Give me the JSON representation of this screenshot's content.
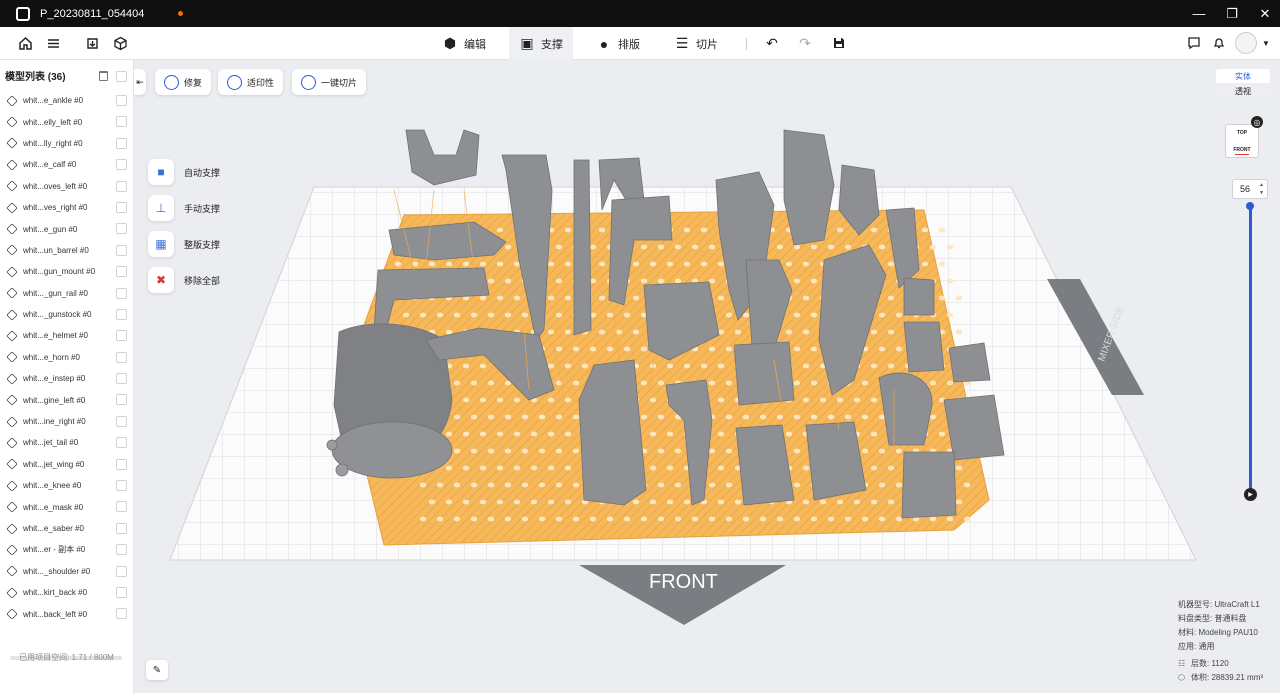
{
  "window": {
    "title": "P_20230811_054404",
    "controls": [
      "minimize",
      "maximize",
      "close"
    ]
  },
  "toolbar": {
    "tabs": [
      {
        "label": "编辑",
        "icon": "edit-cube-icon"
      },
      {
        "label": "支撑",
        "icon": "support-icon"
      },
      {
        "label": "排版",
        "icon": "arrange-icon"
      },
      {
        "label": "切片",
        "icon": "slice-icon"
      }
    ],
    "active_tab": "支撑"
  },
  "model_list": {
    "title": "模型列表 (36)",
    "items": [
      "whit...e_ankle #0",
      "whit...elly_left #0",
      "whit...lly_right #0",
      "whit...e_calf #0",
      "whit...oves_left #0",
      "whit...ves_right #0",
      "whit...e_gun #0",
      "whit...un_barrel #0",
      "whit...gun_mount #0",
      "whit..._gun_rail #0",
      "whit..._gunstock #0",
      "whit...e_helmet #0",
      "whit...e_horn #0",
      "whit...e_instep #0",
      "whit...gine_left #0",
      "whit...ine_right #0",
      "whit...jet_tail #0",
      "whit...jet_wing #0",
      "whit...e_knee #0",
      "whit...e_mask #0",
      "whit...e_saber #0",
      "whit...er - 副本 #0",
      "whit..._shoulder #0",
      "whit...kirt_back #0",
      "whit...back_left #0"
    ],
    "storage": "已用项目空间: 1.71 / 800M",
    "storage_fraction": 0.002
  },
  "actions": {
    "repair": "修复",
    "printability": "适印性",
    "one_click_slice": "一键切片"
  },
  "support_tools": [
    "自动支撑",
    "手动支撑",
    "整版支撑",
    "移除全部"
  ],
  "view": {
    "solid": "实体",
    "transparent": "透视",
    "cube_top": "TOP",
    "cube_front": "FRONT"
  },
  "layer": {
    "value": "56"
  },
  "scene": {
    "front_label": "FRONT",
    "side_label": "MIXER SIDE",
    "colors": {
      "plate": "#ffffff",
      "support": "#f5b54a",
      "model": "#8b8d90",
      "accent": "#2a5bd7"
    }
  },
  "machine_info": {
    "model_line": "机器型号: UltraCraft L1",
    "tank_line": "料盘类型: 普通料盘",
    "material_line": "材料: Modeling PAU10",
    "use_line": "应用: 通用",
    "layers_line": "层数: 1120",
    "volume_line": "体积: 28839.21 mm³"
  }
}
